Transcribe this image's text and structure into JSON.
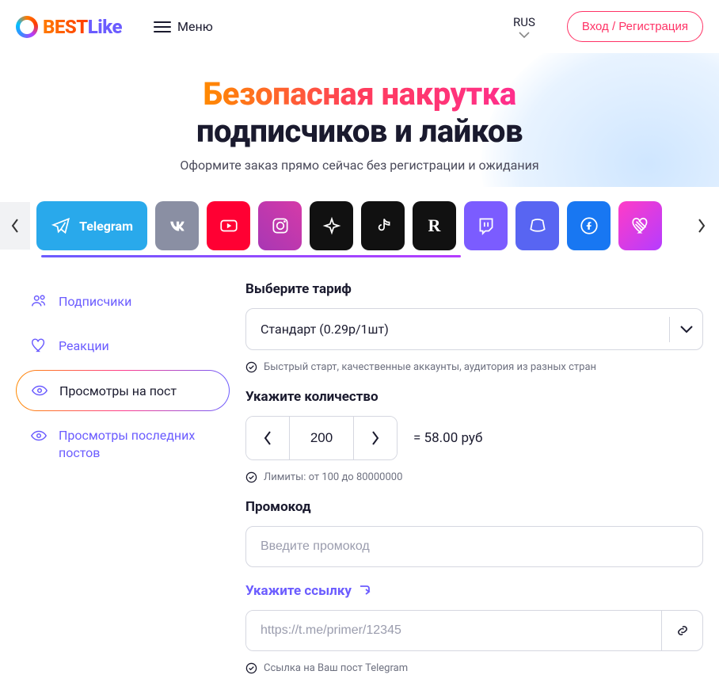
{
  "header": {
    "logo_best": "BEST",
    "logo_like": "Like",
    "menu": "Меню",
    "lang": "RUS",
    "auth": "Вход / Регистрация"
  },
  "hero": {
    "title_grad": "Безопасная накрутка",
    "title_plain": "подписчиков и лайков",
    "subtitle": "Оформите заказ прямо сейчас без регистрации и ожидания"
  },
  "social": {
    "telegram": "Telegram",
    "r": "R"
  },
  "sidebar": {
    "items": [
      {
        "label": "Подписчики"
      },
      {
        "label": "Реакции"
      },
      {
        "label": "Просмотры на пост"
      },
      {
        "label": "Просмотры последних постов"
      }
    ]
  },
  "form": {
    "tariff_label": "Выберите тариф",
    "tariff_value": "Стандарт (0.29р/1шт)",
    "tariff_hint": "Быстрый старт, качественные аккаунты, аудитория из разных стран",
    "qty_label": "Укажите количество",
    "qty_value": "200",
    "price": "= 58.00 руб",
    "qty_hint": "Лимиты: от 100 до 80000000",
    "promo_label": "Промокод",
    "promo_placeholder": "Введите промокод",
    "link_label": "Укажите ссылку",
    "link_placeholder": "https://t.me/primer/12345",
    "link_hint": "Ссылка на Ваш пост Telegram"
  }
}
